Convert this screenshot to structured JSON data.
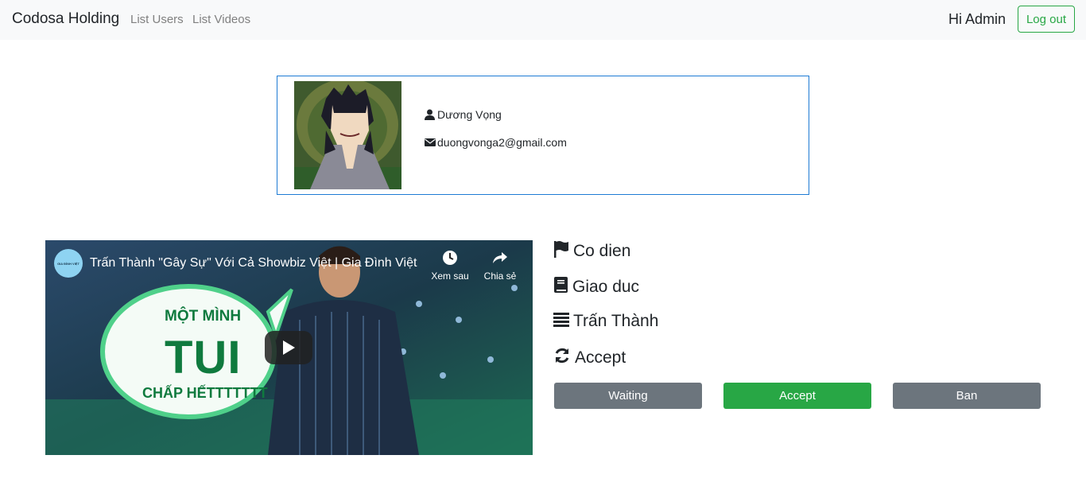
{
  "navbar": {
    "brand": "Codosa Holding",
    "links": [
      "List Users",
      "List Videos"
    ],
    "greeting": "Hi Admin",
    "logout_label": "Log out"
  },
  "profile": {
    "name": "Dương Vọng",
    "email": "duongvonga2@gmail.com",
    "name_icon": "user-icon",
    "email_icon": "envelope-icon"
  },
  "video": {
    "channel_logo_text": "GIA ĐÌNH VIỆT",
    "title": "Trấn Thành \"Gây Sự\" Với Cả Showbiz Việt | Gia Đình Việt",
    "watch_later_label": "Xem sau",
    "share_label": "Chia sẻ",
    "thumbnail_text": [
      "MỘT MÌNH",
      "TUI",
      "CHẤP HẾTTTTTTT"
    ]
  },
  "info": {
    "category": "Co dien",
    "category_icon": "flag-icon",
    "topic": "Giao duc",
    "topic_icon": "book-icon",
    "author": "Trấn Thành",
    "author_icon": "list-icon",
    "status": "Accept",
    "status_icon": "refresh-icon"
  },
  "actions": {
    "waiting_label": "Waiting",
    "accept_label": "Accept",
    "ban_label": "Ban"
  },
  "colors": {
    "accent_green": "#28a745",
    "secondary_gray": "#6c757d",
    "profile_border": "#1e7bd4",
    "navbar_bg": "#f8f9fa"
  }
}
